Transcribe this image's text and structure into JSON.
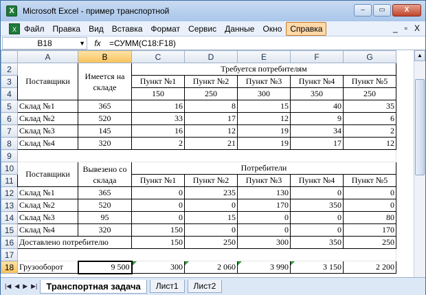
{
  "window": {
    "title": "Microsoft Excel - пример транспортной",
    "icon_letter": "X"
  },
  "window_buttons": [
    "–",
    "▭",
    "X"
  ],
  "menu": [
    "Файл",
    "Правка",
    "Вид",
    "Вставка",
    "Формат",
    "Сервис",
    "Данные",
    "Окно",
    "Справка"
  ],
  "mdi_buttons": [
    "_",
    "▫",
    "X"
  ],
  "namebox": "B18",
  "fx_label": "fx",
  "formula": "=СУММ(C18:F18)",
  "columns": [
    "A",
    "B",
    "C",
    "D",
    "E",
    "F",
    "G"
  ],
  "rows": [
    "2",
    "3",
    "4",
    "5",
    "6",
    "7",
    "8",
    "9",
    "10",
    "11",
    "12",
    "13",
    "14",
    "15",
    "16",
    "17",
    "18"
  ],
  "table1": {
    "h_suppliers": "Поставщики",
    "h_available": "Имеется на складе",
    "h_required": "Требуется потребителям",
    "points": [
      "Пункт №1",
      "Пункт №2",
      "Пункт №3",
      "Пункт №4",
      "Пункт №5"
    ],
    "demand": [
      "150",
      "250",
      "300",
      "350",
      "250"
    ],
    "rows": [
      {
        "name": "Склад №1",
        "stock": "365",
        "v": [
          "16",
          "8",
          "15",
          "40",
          "35"
        ]
      },
      {
        "name": "Склад №2",
        "stock": "520",
        "v": [
          "33",
          "17",
          "12",
          "9",
          "6"
        ]
      },
      {
        "name": "Склад №3",
        "stock": "145",
        "v": [
          "16",
          "12",
          "19",
          "34",
          "2"
        ]
      },
      {
        "name": "Склад №4",
        "stock": "320",
        "v": [
          "2",
          "21",
          "19",
          "17",
          "12"
        ]
      }
    ]
  },
  "table2": {
    "h_suppliers": "Поставщики",
    "h_shipped": "Вывезено со склада",
    "h_consumers": "Потребители",
    "points": [
      "Пункт №1",
      "Пункт №2",
      "Пункт №3",
      "Пункт №4",
      "Пункт №5"
    ],
    "rows": [
      {
        "name": "Склад №1",
        "stock": "365",
        "v": [
          "0",
          "235",
          "130",
          "0",
          "0"
        ]
      },
      {
        "name": "Склад №2",
        "stock": "520",
        "v": [
          "0",
          "0",
          "170",
          "350",
          "0"
        ]
      },
      {
        "name": "Склад №3",
        "stock": "95",
        "v": [
          "0",
          "15",
          "0",
          "0",
          "80"
        ]
      },
      {
        "name": "Склад №4",
        "stock": "320",
        "v": [
          "150",
          "0",
          "0",
          "0",
          "170"
        ]
      }
    ],
    "delivered_label": "Доставлено потребителю",
    "delivered": [
      "150",
      "250",
      "300",
      "350",
      "250"
    ]
  },
  "cargo": {
    "label": "Грузооборот",
    "total": "9 500",
    "v": [
      "300",
      "2 060",
      "3 990",
      "3 150",
      "2 200"
    ]
  },
  "sheets": [
    "Транспортная задача",
    "Лист1",
    "Лист2"
  ],
  "tab_nav": [
    "|◀",
    "◀",
    "▶",
    "▶|"
  ]
}
